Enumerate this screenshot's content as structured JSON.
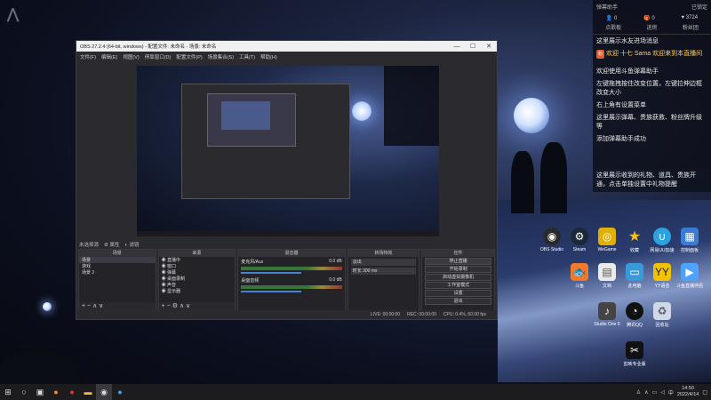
{
  "obs": {
    "title": "OBS 27.2.4 (64-bit, windows) - 配置文件: 未命名 - 场景: 未命名",
    "menu": [
      "文件(F)",
      "编辑(E)",
      "视图(V)",
      "停靠窗口(D)",
      "配置文件(P)",
      "场景集合(S)",
      "工具(T)",
      "帮助(H)"
    ],
    "preview_tabs": [
      "未选择源",
      "属性",
      "滤镜"
    ],
    "scenes": {
      "header": "场景",
      "items": [
        "场景",
        "游戏",
        "场景 2"
      ]
    },
    "sources": {
      "header": "来源",
      "items": [
        "直播中",
        "窗口",
        "弹幕",
        "桌面录制",
        "声音",
        "显示器"
      ]
    },
    "mixer": {
      "header": "混音器",
      "tracks": [
        {
          "name": "桌面音频",
          "level": "0.0 dB"
        },
        {
          "name": "麦克风/Aux",
          "level": "0.0 dB"
        }
      ]
    },
    "transitions": {
      "header": "转场特效",
      "selected": "淡出",
      "duration_label": "时长",
      "duration": "300 ms"
    },
    "controls": {
      "header": "控件",
      "buttons": [
        "停止直播",
        "开始录制",
        "启动虚拟摄像机",
        "工作室模式",
        "设置",
        "退出"
      ]
    },
    "status": {
      "live": "LIVE: 00:00:00",
      "rec": "REC: 00:00:00",
      "cpu": "CPU: 0.4%, 60.00 fps"
    }
  },
  "panel": {
    "title": "弹幕助手",
    "lock": "已锁定",
    "stats": [
      {
        "icon": "user-icon",
        "value": "0"
      },
      {
        "icon": "gift-icon",
        "value": "0"
      },
      {
        "icon": "heart-icon",
        "value": "3724"
      }
    ],
    "tabs": [
      "点歌板",
      "进房",
      "粉丝团"
    ],
    "messages": [
      "这里展示水友进场消息",
      "欢迎 十七 Sama 欢迎来到本直播间",
      "欢迎使用斗鱼弹幕助手",
      "左键拖拽按住改变位置，左键拉伸边框改变大小",
      "右上角有设置菜单",
      "这里展示弹幕、贵族获救、粉丝牌升级等",
      "添加弹幕助手成功"
    ],
    "notice": "这里展示收到的礼物、道具、贵族开通，点击单独设置中礼物提醒"
  },
  "desktop_icons": [
    {
      "label": "OBS Studio",
      "icon": "obs-icon",
      "color": "#2a2a2a"
    },
    {
      "label": "Steam",
      "icon": "steam-icon",
      "color": "#1b2838"
    },
    {
      "label": "WeGame",
      "icon": "wegame-icon",
      "color": "#e0b000"
    },
    {
      "label": "收藏",
      "icon": "star-icon",
      "color": "#d4a012"
    },
    {
      "label": "网易UU加速",
      "icon": "uu-icon",
      "color": "#2ba3e0"
    },
    {
      "label": "控制面板",
      "icon": "control-panel-icon",
      "color": "#3a7bd5"
    },
    {
      "label": "斗鱼",
      "icon": "douyu-icon",
      "color": "#f07a2a"
    },
    {
      "label": "文档",
      "icon": "file-icon",
      "color": "#eaeaea"
    },
    {
      "label": "此电脑",
      "icon": "computer-icon",
      "color": "#3a9ad9"
    },
    {
      "label": "YY语音",
      "icon": "yy-icon",
      "color": "#f2c200"
    },
    {
      "label": "斗鱼直播伴侣",
      "icon": "douyu-companion-icon",
      "color": "#4da3ff"
    },
    {
      "label": "Studio One 5",
      "icon": "studio-one-icon",
      "color": "#444"
    },
    {
      "label": "腾讯QQ",
      "icon": "qq-icon",
      "color": "#111"
    },
    {
      "label": "回收站",
      "icon": "recycle-bin-icon",
      "color": "#cfd8e6"
    },
    {
      "label": "剪映专业版",
      "icon": "capcut-icon",
      "color": "#111"
    }
  ],
  "taskbar": {
    "time": "14:50",
    "date": "2022/4/14",
    "ime": "中",
    "apps": [
      "start-icon",
      "search-icon",
      "task-view-icon",
      "firefox-icon",
      "netease-music-icon",
      "file-explorer-icon",
      "obs-icon",
      "browser-icon"
    ]
  }
}
